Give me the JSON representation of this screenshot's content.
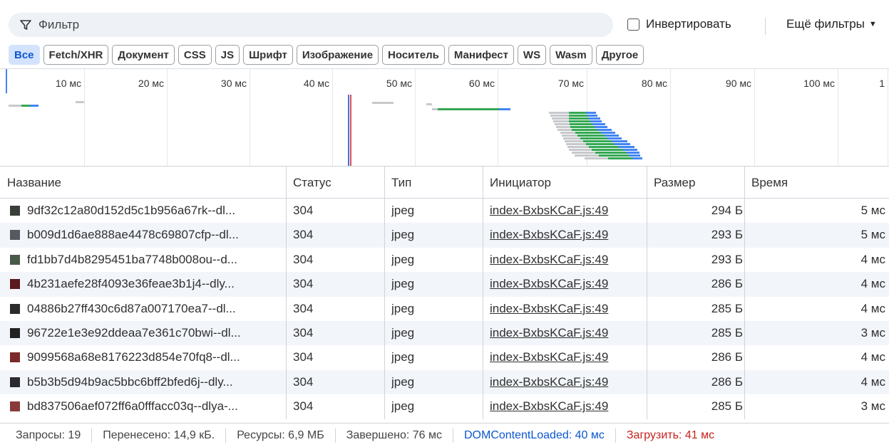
{
  "filter": {
    "placeholder": "Фильтр",
    "invert_label": "Инвертировать",
    "more_filters": "Ещё фильтры"
  },
  "type_chips": [
    "Все",
    "Fetch/XHR",
    "Документ",
    "CSS",
    "JS",
    "Шрифт",
    "Изображение",
    "Носитель",
    "Манифест",
    "WS",
    "Wasm",
    "Другое"
  ],
  "active_chip": "Все",
  "timeline_ticks": [
    "10 мс",
    "20 мс",
    "30 мс",
    "40 мс",
    "50 мс",
    "60 мс",
    "70 мс",
    "80 мс",
    "90 мс",
    "100 мс",
    "1"
  ],
  "columns": {
    "name": "Название",
    "status": "Статус",
    "type": "Тип",
    "initiator": "Инициатор",
    "size": "Размер",
    "time": "Время"
  },
  "rows": [
    {
      "name": "9df32c12a80d152d5c1b956a67rk--dl...",
      "status": "304",
      "type": "jpeg",
      "initiator": "index-BxbsKCaF.js:49",
      "size": "294 Б",
      "time": "5 мс",
      "thumb_color": "#3a3f3a"
    },
    {
      "name": "b009d1d6ae888ae4478c69807cfp--dl...",
      "status": "304",
      "type": "jpeg",
      "initiator": "index-BxbsKCaF.js:49",
      "size": "293 Б",
      "time": "5 мс",
      "thumb_color": "#555a60"
    },
    {
      "name": "fd1bb7d4b8295451ba7748b008ou--d...",
      "status": "304",
      "type": "jpeg",
      "initiator": "index-BxbsKCaF.js:49",
      "size": "293 Б",
      "time": "4 мс",
      "thumb_color": "#4a5a48"
    },
    {
      "name": "4b231aefe28f4093e36feae3b1j4--dly...",
      "status": "304",
      "type": "jpeg",
      "initiator": "index-BxbsKCaF.js:49",
      "size": "286 Б",
      "time": "4 мс",
      "thumb_color": "#5a1a1e"
    },
    {
      "name": "04886b27ff430c6d87a007170ea7--dl...",
      "status": "304",
      "type": "jpeg",
      "initiator": "index-BxbsKCaF.js:49",
      "size": "285 Б",
      "time": "4 мс",
      "thumb_color": "#2a2a2a"
    },
    {
      "name": "96722e1e3e92ddeaa7e361c70bwi--dl...",
      "status": "304",
      "type": "jpeg",
      "initiator": "index-BxbsKCaF.js:49",
      "size": "285 Б",
      "time": "3 мс",
      "thumb_color": "#222222"
    },
    {
      "name": "9099568a68e8176223d854e70fq8--dl...",
      "status": "304",
      "type": "jpeg",
      "initiator": "index-BxbsKCaF.js:49",
      "size": "286 Б",
      "time": "4 мс",
      "thumb_color": "#7a2a2a"
    },
    {
      "name": "b5b3b5d94b9ac5bbc6bff2bfed6j--dly...",
      "status": "304",
      "type": "jpeg",
      "initiator": "index-BxbsKCaF.js:49",
      "size": "286 Б",
      "time": "4 мс",
      "thumb_color": "#2c2c30"
    },
    {
      "name": "bd837506aef072ff6a0fffacc03q--dlya-...",
      "status": "304",
      "type": "jpeg",
      "initiator": "index-BxbsKCaF.js:49",
      "size": "285 Б",
      "time": "3 мс",
      "thumb_color": "#8a3a3a"
    }
  ],
  "status_bar": {
    "requests": "Запросы: 19",
    "transferred": "Перенесено: 14,9 кБ.",
    "resources": "Ресурсы: 6,9 МБ",
    "finished": "Завершено: 76 мс",
    "dom_content_loaded": "DOMContentLoaded: 40 мс",
    "load": "Загрузить: 41 мс"
  },
  "colors": {
    "accent": "#0b57d0",
    "chip_active_bg": "#d3e3fd",
    "waterfall_green": "#34a853",
    "waterfall_blue": "#4285f4",
    "dcl_line": "#4a6fd8",
    "load_line": "#d9534f"
  }
}
